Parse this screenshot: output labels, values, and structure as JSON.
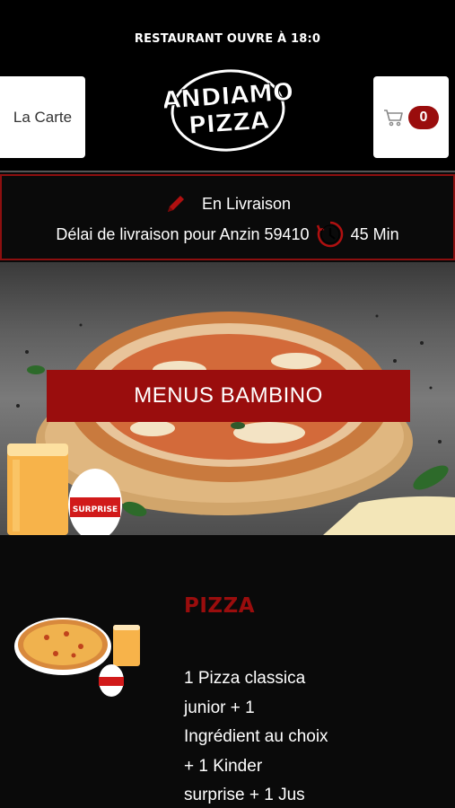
{
  "header": {
    "banner": "RESTAURANT OUVRE À 18:0",
    "menu_label": "La Carte",
    "logo_line1": "ANDIAMO",
    "logo_line2": "PIZZA",
    "cart_count": "0"
  },
  "delivery": {
    "mode": "En Livraison",
    "delay_text": "Délai de livraison pour Anzin 59410",
    "delay_value": "45 Min"
  },
  "hero": {
    "title": "MENUS BAMBINO",
    "egg_label": "SURPRISE"
  },
  "product": {
    "title": "PIZZA",
    "description": "1 Pizza classica\njunior  + 1\nIngrédient au choix\n + 1 Kinder\nsurprise  + 1 Jus"
  },
  "colors": {
    "accent": "#9a0d0d",
    "background": "#0a0a0a",
    "border": "#8d0f0f"
  }
}
